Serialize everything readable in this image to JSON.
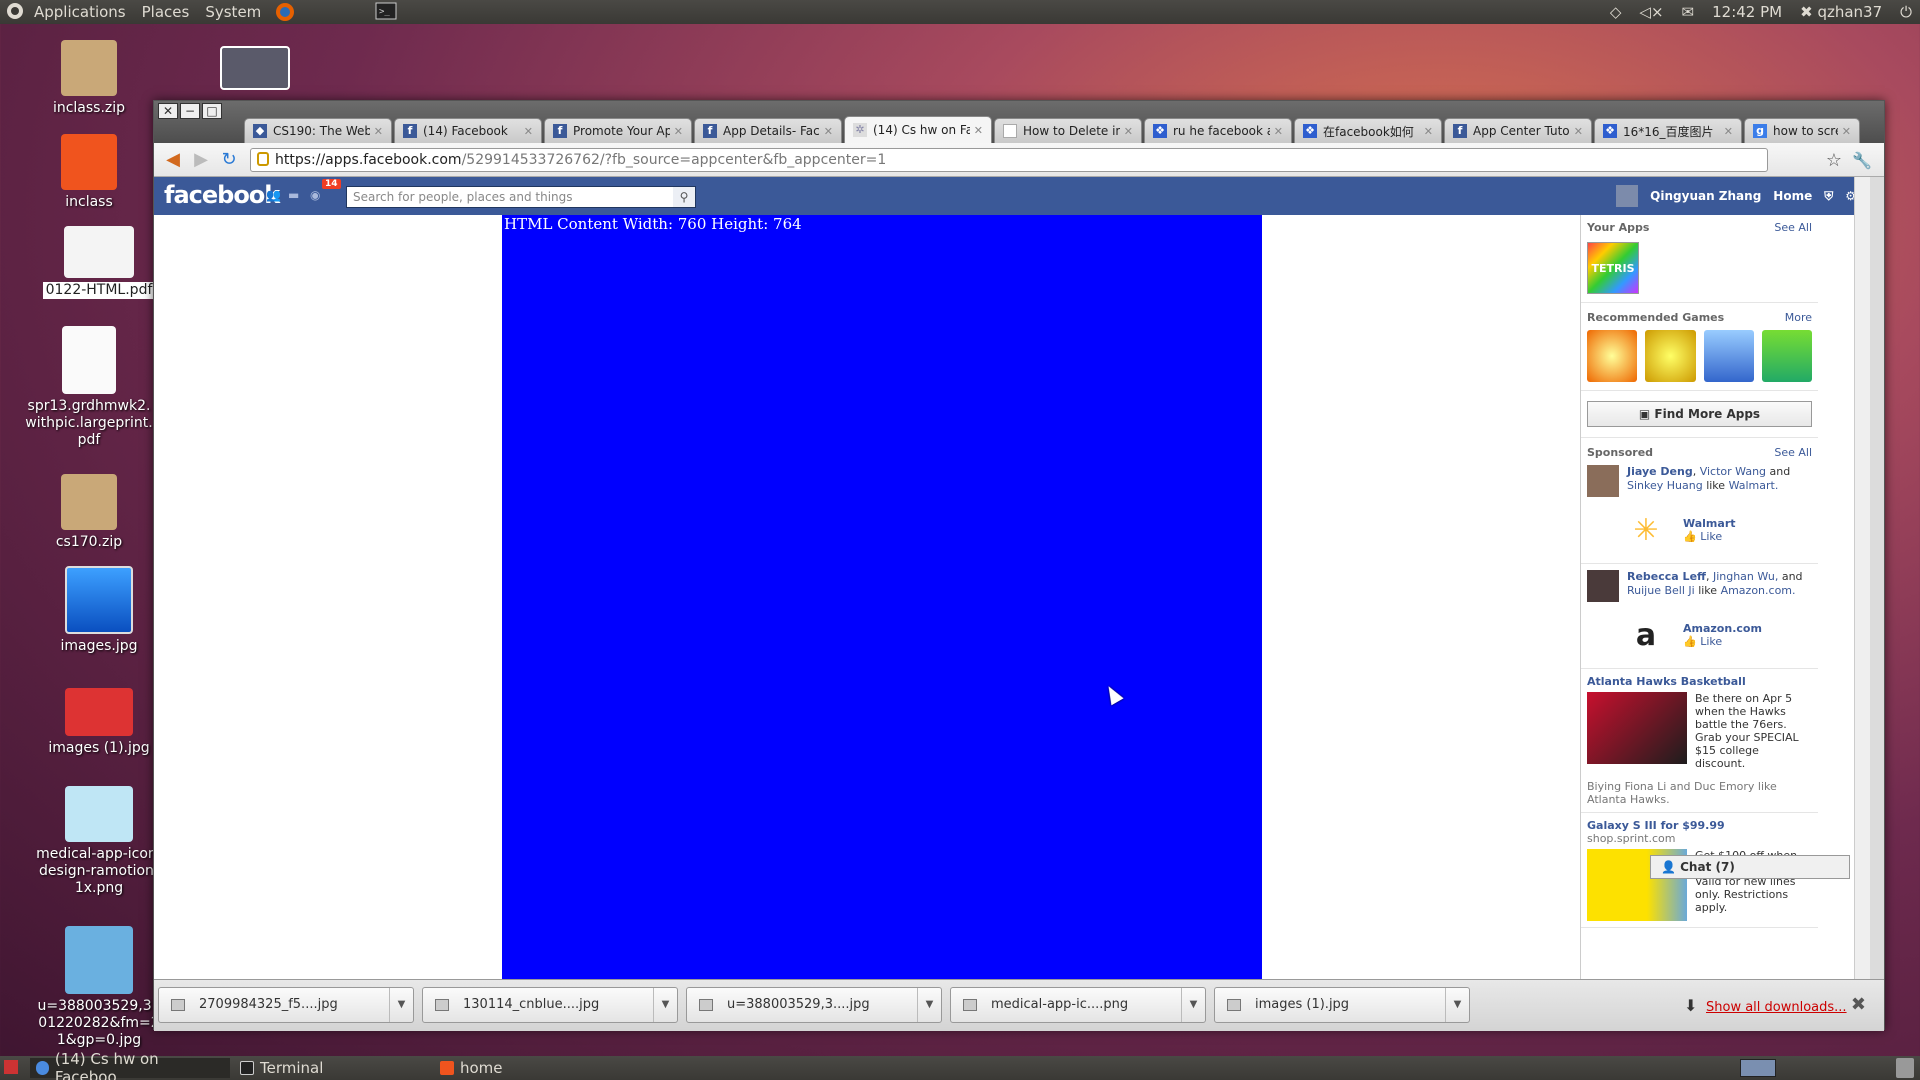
{
  "top_panel": {
    "menus": [
      "Applications",
      "Places",
      "System"
    ],
    "clock": "12:42 PM",
    "user": "qzhan37"
  },
  "desktop_icons": [
    {
      "label": "inclass.zip"
    },
    {
      "label": "inclass"
    },
    {
      "label": "0122-HTML.pdf"
    },
    {
      "label": "spr13.grdhmwk2.withpic.largeprint.pdf"
    },
    {
      "label": "cs170.zip"
    },
    {
      "label": "images.jpg"
    },
    {
      "label": "images (1).jpg"
    },
    {
      "label": "medical-app-icon-design-ramotion-1x.png"
    },
    {
      "label": "u=388003529,3101220282&fm=21&gp=0.jpg"
    }
  ],
  "browser": {
    "tabs": [
      {
        "label": "CS190: The Web"
      },
      {
        "label": "(14) Facebook"
      },
      {
        "label": "Promote Your Ap"
      },
      {
        "label": "App Details- Face"
      },
      {
        "label": "(14) Cs hw on Fac"
      },
      {
        "label": "How to Delete in"
      },
      {
        "label": "ru he facebook a"
      },
      {
        "label": "在facebook如何"
      },
      {
        "label": "App Center Tutor"
      },
      {
        "label": "16*16_百度图片"
      },
      {
        "label": "how to screensho"
      }
    ],
    "url_host": "https://apps.facebook.com",
    "url_path": "/529914533726762/?fb_source=appcenter&fb_appcenter=1"
  },
  "facebook": {
    "logo": "facebook",
    "notification_count": "14",
    "search_placeholder": "Search for people, places and things",
    "user_name": "Qingyuan Zhang",
    "home_label": "Home",
    "app_text": "HTML Content Width: 760 Height: 764",
    "sidebar": {
      "your_apps": "Your Apps",
      "see_all": "See All",
      "recommended_games": "Recommended Games",
      "more": "More",
      "find_more_apps": "Find More Apps",
      "sponsored": "Sponsored",
      "sponsored_see_all": "See All",
      "ad1_names_1": "Jiaye Deng",
      "ad1_names_2": "Victor Wang",
      "ad1_and": " and ",
      "ad1_names_3": "Sinkey Huang",
      "ad1_like": " like ",
      "ad1_page": "Walmart.",
      "ad1_brand": "Walmart",
      "like_label": "Like",
      "ad2_names_1": "Rebecca Leff",
      "ad2_names_2": "Jinghan Wu,",
      "ad2_and": "and ",
      "ad2_names_3": "Ruijue Bell Ji",
      "ad2_like": " like ",
      "ad2_page": "Amazon.com.",
      "ad2_brand": "Amazon.com",
      "ad3_title": "Atlanta Hawks Basketball",
      "ad3_text": "Be there on Apr 5 when the Hawks battle the 76ers. Grab your SPECIAL $15 college discount.",
      "ad3_social": "Biying Fiona Li and Duc Emory like Atlanta Hawks.",
      "ad4_title": "Galaxy S III for $99.99",
      "ad4_domain": "shop.sprint.com",
      "ad4_text": "Get $100 off when you switch to Sprint. Valid for new lines only. Restrictions apply."
    },
    "chat_label": "Chat (7)"
  },
  "downloads": {
    "items": [
      "2709984325_f5....jpg",
      "130114_cnblue....jpg",
      "u=388003529,3....jpg",
      "medical-app-ic....png",
      "images (1).jpg"
    ],
    "show_all": "Show all downloads..."
  },
  "taskbar": {
    "items": [
      "(14) Cs hw on Faceboo...",
      "Terminal",
      "home"
    ]
  }
}
